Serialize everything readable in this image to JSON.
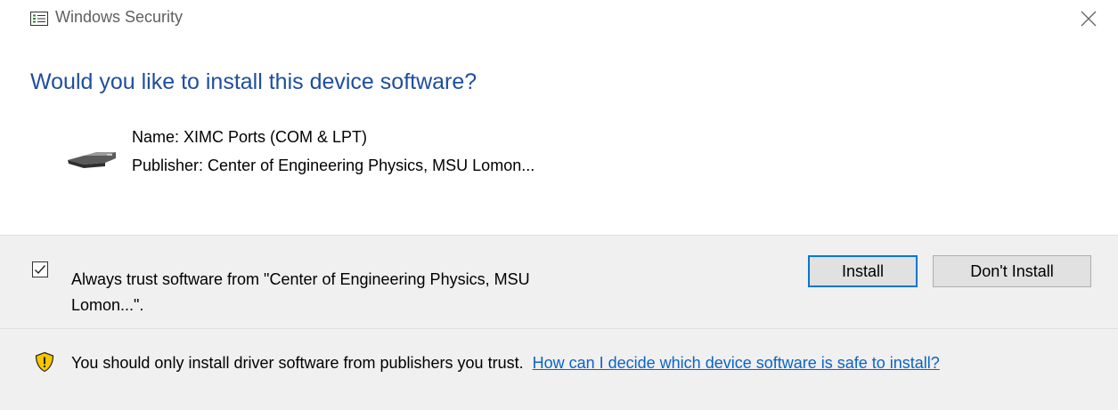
{
  "window": {
    "title": "Windows Security",
    "icon": "security-icon",
    "close_icon": "close-icon"
  },
  "dialog": {
    "question": "Would you like to install this device software?",
    "device": {
      "icon": "device-icon",
      "name": "Name: XIMC Ports (COM & LPT)",
      "publisher": "Publisher: Center of Engineering Physics, MSU Lomon..."
    },
    "trust_checkbox": {
      "checked": true,
      "label": "Always trust software from \"Center of Engineering Physics, MSU Lomon...\"."
    },
    "buttons": {
      "install": "Install",
      "dont_install": "Don't Install"
    },
    "warning": {
      "icon": "shield-warning-icon",
      "text": "You should only install driver software from publishers you trust.",
      "link": "How can I decide which device software is safe to install?"
    }
  },
  "colors": {
    "heading": "#1e4e9e",
    "link": "#0a64c8",
    "footer_bg": "#f0f0f0",
    "focus_border": "#0078d7",
    "shield_yellow": "#f7c600"
  }
}
